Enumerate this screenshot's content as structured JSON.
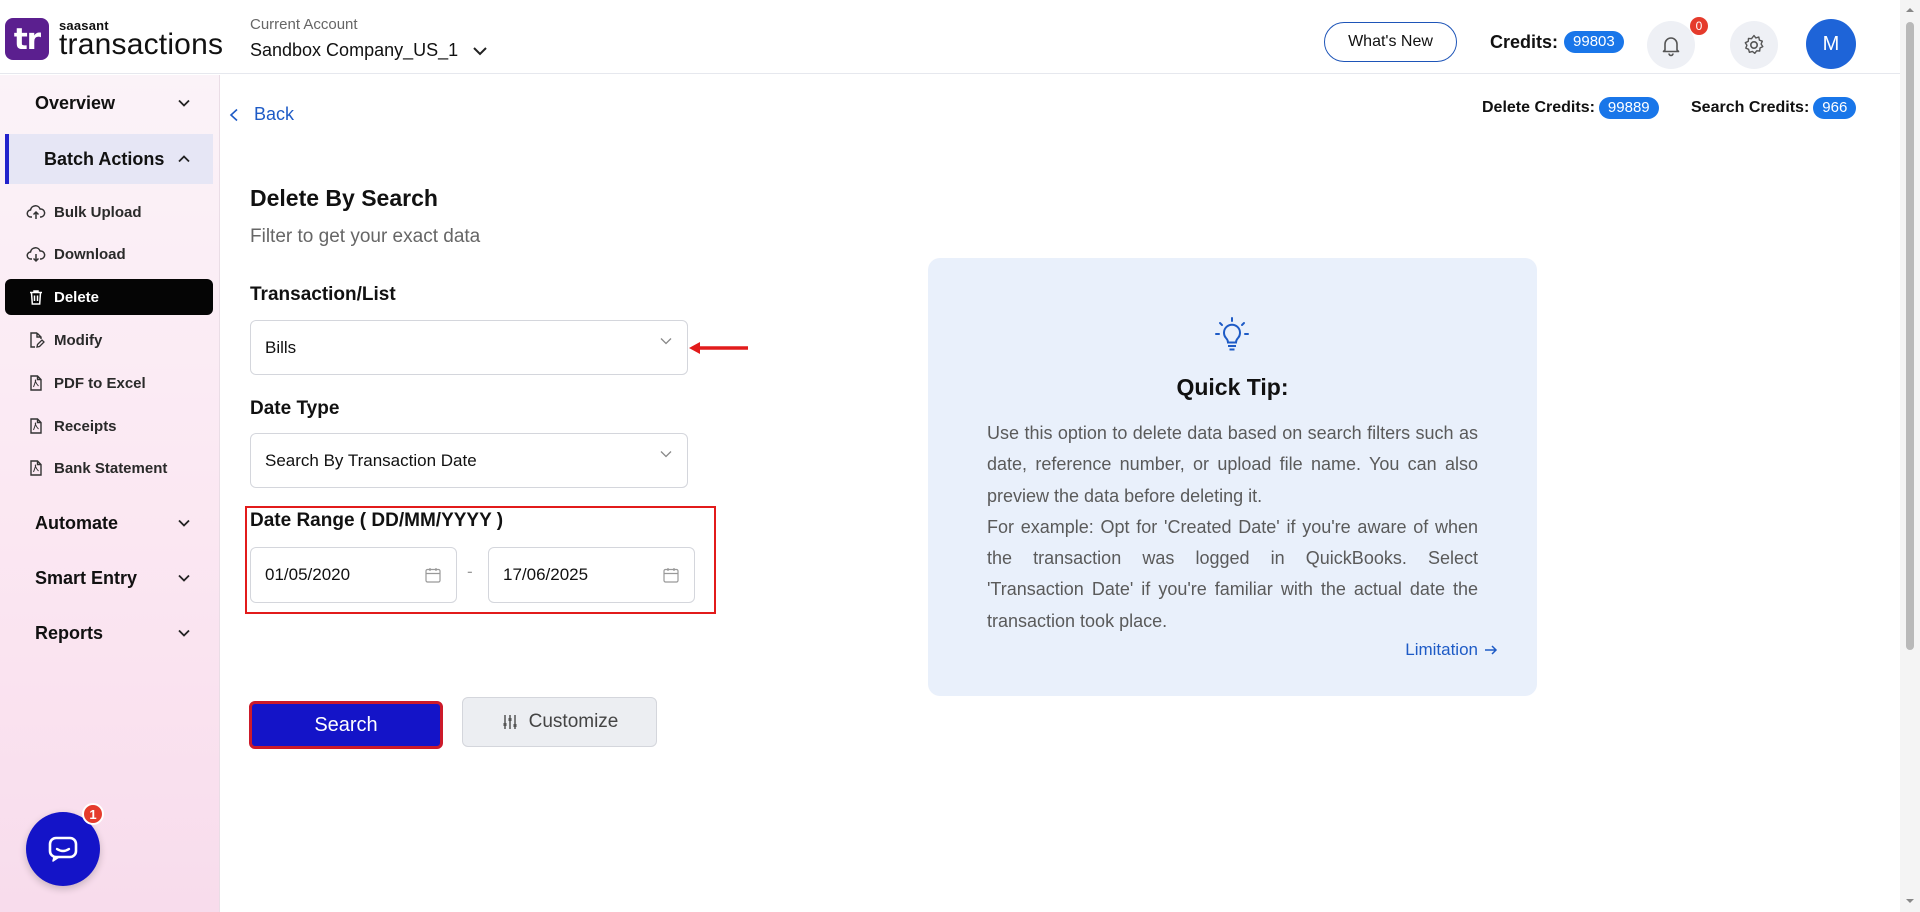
{
  "header": {
    "logo_small": "saasant",
    "logo_big": "transactions",
    "logo_mark": "tr",
    "account_label": "Current Account",
    "account_name": "Sandbox Company_US_1",
    "whats_new": "What's New",
    "credits_label": "Credits:",
    "credits_value": "99803",
    "notifications_count": "0",
    "avatar_initial": "M"
  },
  "sidebar": {
    "groups": {
      "overview": "Overview",
      "batch_actions": "Batch Actions",
      "automate": "Automate",
      "smart_entry": "Smart Entry",
      "reports": "Reports"
    },
    "items": [
      {
        "label": "Bulk Upload",
        "icon": "cloud-upload-icon"
      },
      {
        "label": "Download",
        "icon": "cloud-download-icon"
      },
      {
        "label": "Delete",
        "icon": "trash-icon",
        "selected": true
      },
      {
        "label": "Modify",
        "icon": "file-edit-icon"
      },
      {
        "label": "PDF to Excel",
        "icon": "pdf-file-icon"
      },
      {
        "label": "Receipts",
        "icon": "pdf-file-icon"
      },
      {
        "label": "Bank Statement",
        "icon": "pdf-file-icon"
      }
    ],
    "chat_badge": "1"
  },
  "main": {
    "back_label": "Back",
    "delete_credits_label": "Delete Credits:",
    "delete_credits_value": "99889",
    "search_credits_label": "Search Credits:",
    "search_credits_value": "966",
    "title": "Delete By Search",
    "subtitle": "Filter to get your exact data",
    "transaction_label": "Transaction/List",
    "transaction_value": "Bills",
    "date_type_label": "Date Type",
    "date_type_value": "Search By Transaction Date",
    "date_range_label": "Date Range ( DD/MM/YYYY )",
    "date_from": "01/05/2020",
    "date_separator": "-",
    "date_to": "17/06/2025",
    "search_button": "Search",
    "customize_button": "Customize"
  },
  "tip": {
    "title": "Quick Tip:",
    "paragraph1": "Use this option to delete data based on search filters such as date, reference number, or upload file name. You can also preview the data before deleting it.",
    "paragraph2": "For example: Opt for 'Created Date' if you're aware of when the transaction was logged in QuickBooks. Select 'Transaction Date' if you're familiar with the actual date the transaction took place.",
    "limitation": "Limitation"
  },
  "colors": {
    "brand_purple": "#5b1f8f",
    "primary_blue": "#1414c8",
    "link_blue": "#1e5bc6",
    "badge_blue": "#1976e9",
    "alert_red": "#e21b1b"
  }
}
